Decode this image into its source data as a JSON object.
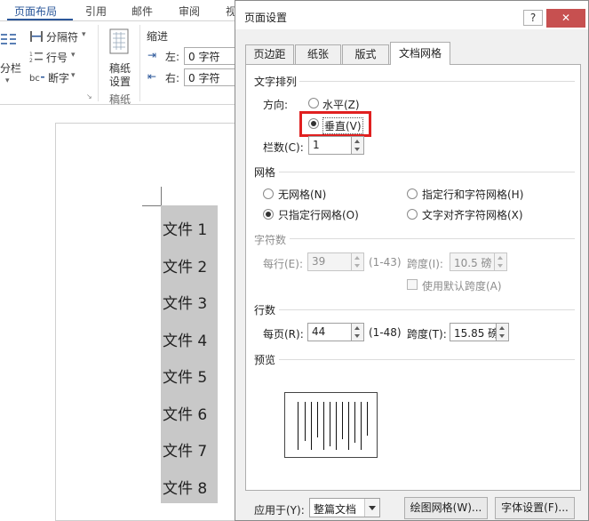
{
  "ribbon": {
    "tabs": [
      {
        "label": "页面布局"
      },
      {
        "label": "引用"
      },
      {
        "label": "邮件"
      },
      {
        "label": "审阅"
      },
      {
        "label": "视图"
      }
    ],
    "columns_label": "分栏",
    "breaks_label": "分隔符",
    "line_numbers_label": "行号",
    "hyphenation_label": "断字",
    "manuscript_label_1": "稿纸",
    "manuscript_label_2": "设置",
    "manuscript_group": "稿纸",
    "indent_header": "缩进",
    "indent_left_label": "左:",
    "indent_left_value": "0 字符",
    "indent_right_label": "右:",
    "indent_right_value": "0 字符"
  },
  "document": {
    "lines": [
      "文件 1",
      "文件 2",
      "文件 3",
      "文件 4",
      "文件 5",
      "文件 6",
      "文件 7",
      "文件 8"
    ]
  },
  "dialog": {
    "title": "页面设置",
    "help": "?",
    "close": "✕",
    "tabs": [
      {
        "label": "页边距"
      },
      {
        "label": "纸张"
      },
      {
        "label": "版式"
      },
      {
        "label": "文档网格"
      }
    ],
    "text_direction": {
      "section": "文字排列",
      "direction_label": "方向:",
      "horizontal": "水平(Z)",
      "vertical": "垂直(V)",
      "columns_label": "栏数(C):",
      "columns_value": "1"
    },
    "grid": {
      "section": "网格",
      "none": "无网格(N)",
      "line_and_char": "指定行和字符网格(H)",
      "lines_only": "只指定行网格(O)",
      "snap_to_chars": "文字对齐字符网格(X)"
    },
    "characters": {
      "section": "字符数",
      "per_line_label": "每行(E):",
      "per_line_value": "39",
      "per_line_range": "(1-43)",
      "pitch_label": "跨度(I):",
      "pitch_value": "10.5 磅",
      "use_default_pitch": "使用默认跨度(A)"
    },
    "lines": {
      "section": "行数",
      "per_page_label": "每页(R):",
      "per_page_value": "44",
      "per_page_range": "(1-48)",
      "pitch_label": "跨度(T):",
      "pitch_value": "15.85 磅"
    },
    "preview": {
      "section": "预览"
    },
    "apply_to_label": "应用于(Y):",
    "apply_to_value": "整篇文档",
    "draw_grid_button": "绘图网格(W)...",
    "font_settings_button": "字体设置(F)..."
  },
  "colors": {
    "accent": "#2b579a",
    "highlight": "#e02020",
    "close": "#c75050"
  }
}
